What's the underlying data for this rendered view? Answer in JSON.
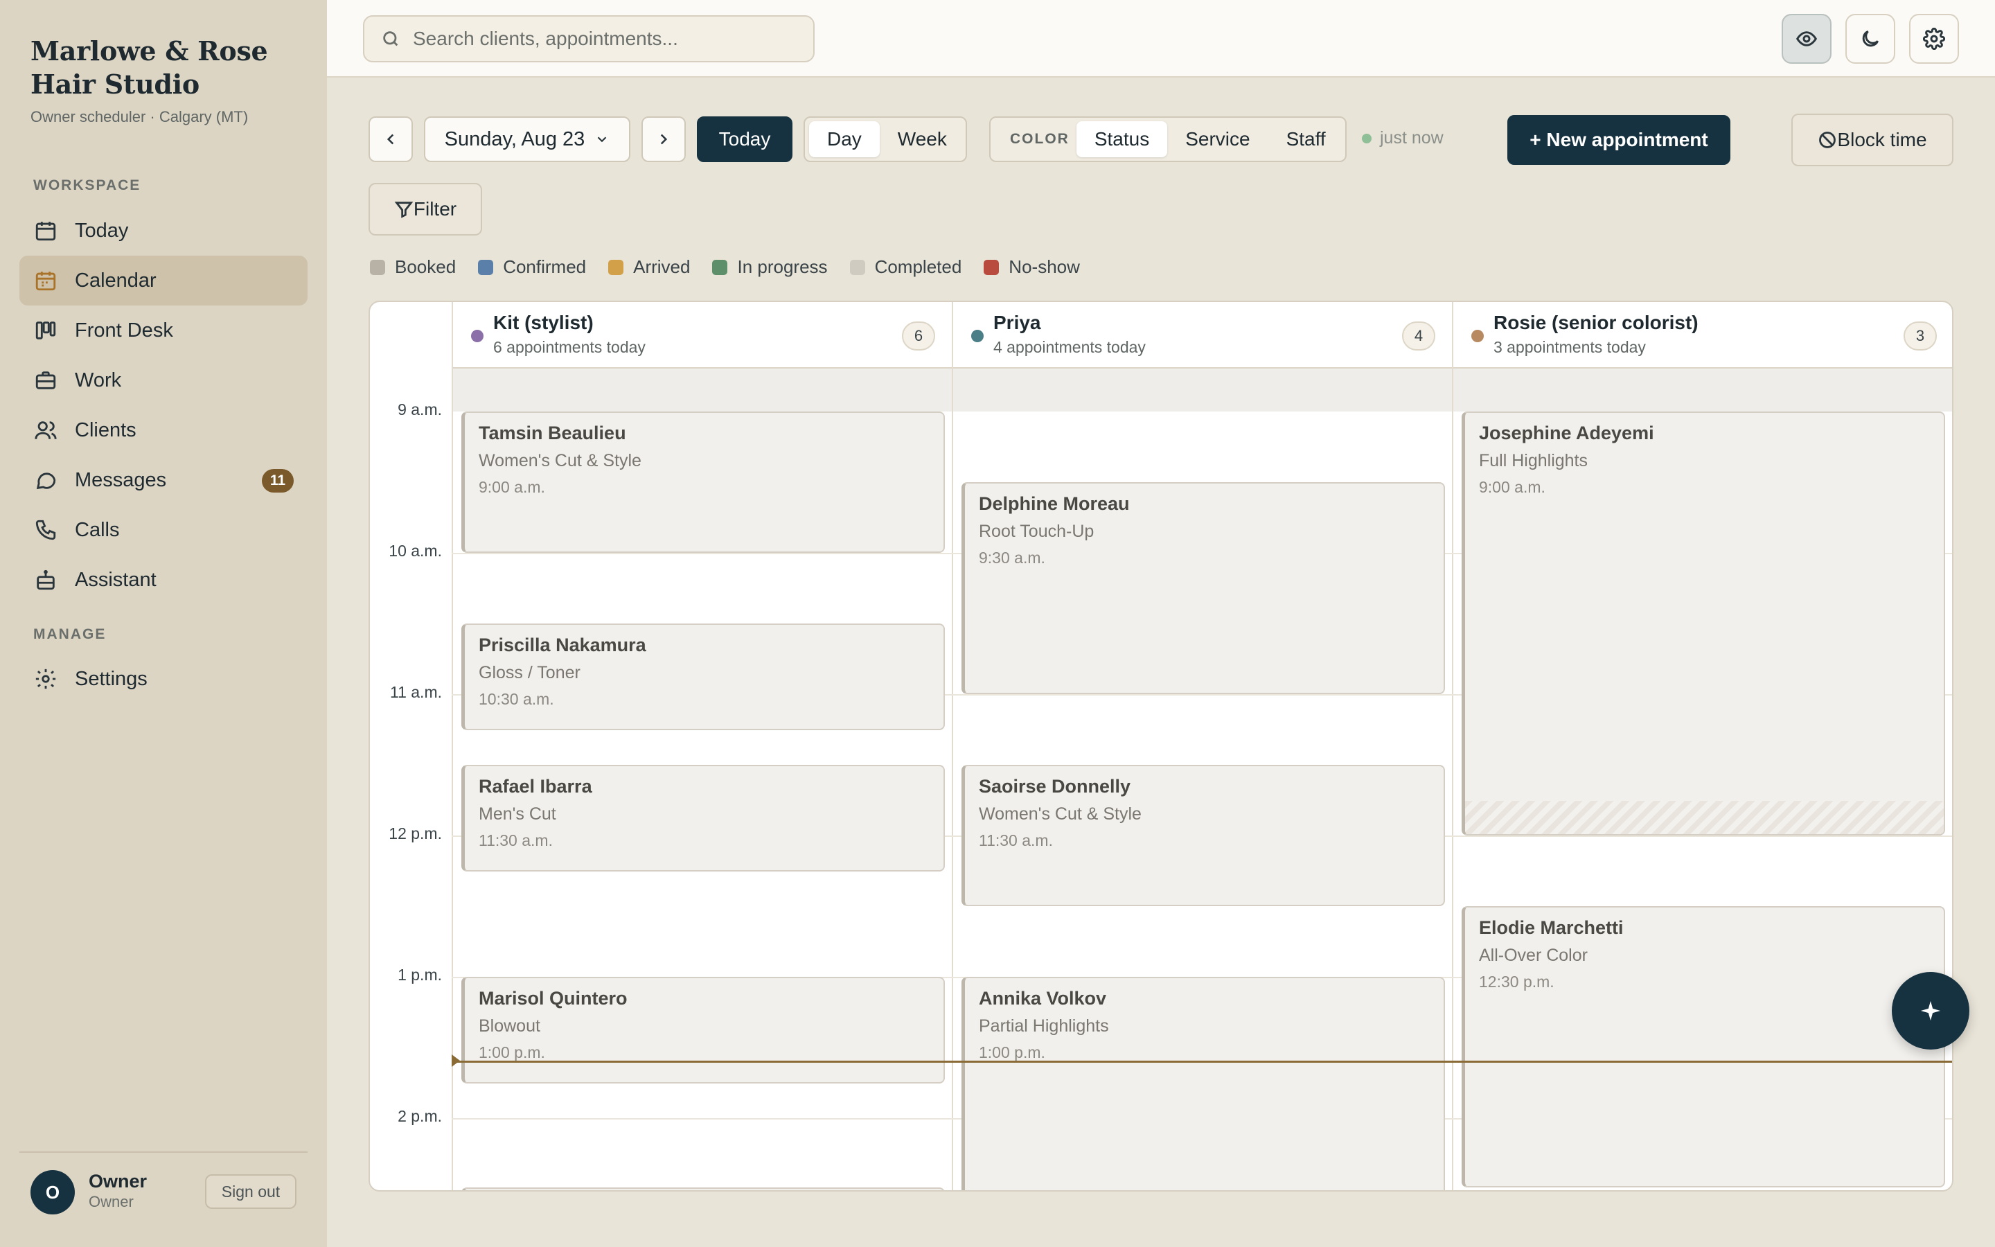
{
  "brand": {
    "name": "Marlowe & Rose Hair Studio",
    "subtitle": "Owner scheduler · Calgary (MT)"
  },
  "sidebar": {
    "workspace_label": "WORKSPACE",
    "manage_label": "MANAGE",
    "items": [
      {
        "label": "Today",
        "icon": "calendar-icon"
      },
      {
        "label": "Calendar",
        "icon": "calendar-grid-icon",
        "active": true
      },
      {
        "label": "Front Desk",
        "icon": "kanban-icon"
      },
      {
        "label": "Work",
        "icon": "briefcase-icon"
      },
      {
        "label": "Clients",
        "icon": "users-icon"
      },
      {
        "label": "Messages",
        "icon": "chat-icon",
        "badge": "11"
      },
      {
        "label": "Calls",
        "icon": "phone-icon"
      },
      {
        "label": "Assistant",
        "icon": "bot-icon"
      }
    ],
    "manage_items": [
      {
        "label": "Settings",
        "icon": "gear-icon"
      }
    ]
  },
  "user": {
    "initial": "O",
    "name": "Owner",
    "role": "Owner",
    "signout_label": "Sign out"
  },
  "search": {
    "placeholder": "Search clients, appointments..."
  },
  "topbar": {
    "icons": [
      "eye-icon",
      "moon-icon",
      "gear-icon"
    ]
  },
  "toolbar": {
    "date_label": "Sunday, Aug 23",
    "today_label": "Today",
    "view_options": [
      "Day",
      "Week"
    ],
    "view_selected": "Day",
    "color_label": "COLOR",
    "color_options": [
      "Status",
      "Service",
      "Staff"
    ],
    "color_selected": "Status",
    "sync_status": "just now",
    "new_appointment_label": "+ New appointment",
    "block_time_label": "Block time",
    "filter_label": "Filter"
  },
  "legend": [
    {
      "label": "Booked",
      "color": "#b7b1a6"
    },
    {
      "label": "Confirmed",
      "color": "#5a7fa8"
    },
    {
      "label": "Arrived",
      "color": "#d2a048"
    },
    {
      "label": "In progress",
      "color": "#5c8f6a"
    },
    {
      "label": "Completed",
      "color": "#d0cbc1"
    },
    {
      "label": "No-show",
      "color": "#b84a3e"
    }
  ],
  "calendar": {
    "hours": [
      "9 a.m.",
      "10 a.m.",
      "11 a.m.",
      "12 p.m.",
      "1 p.m.",
      "2 p.m."
    ],
    "columns": [
      {
        "name": "Kit (stylist)",
        "count_text": "6 appointments today",
        "count": "6",
        "color": "#8a6fa8",
        "appointments": [
          {
            "client": "Tamsin Beaulieu",
            "service": "Women's Cut & Style",
            "time": "9:00 a.m."
          },
          {
            "client": "Priscilla Nakamura",
            "service": "Gloss / Toner",
            "time": "10:30 a.m."
          },
          {
            "client": "Rafael Ibarra",
            "service": "Men's Cut",
            "time": "11:30 a.m."
          },
          {
            "client": "Marisol Quintero",
            "service": "Blowout",
            "time": "1:00 p.m."
          }
        ]
      },
      {
        "name": "Priya",
        "count_text": "4 appointments today",
        "count": "4",
        "color": "#4a7f88",
        "appointments": [
          {
            "client": "Delphine Moreau",
            "service": "Root Touch-Up",
            "time": "9:30 a.m."
          },
          {
            "client": "Saoirse Donnelly",
            "service": "Women's Cut & Style",
            "time": "11:30 a.m."
          },
          {
            "client": "Annika Volkov",
            "service": "Partial Highlights",
            "time": "1:00 p.m."
          }
        ]
      },
      {
        "name": "Rosie (senior colorist)",
        "count_text": "3 appointments today",
        "count": "3",
        "color": "#b88a62",
        "appointments": [
          {
            "client": "Josephine Adeyemi",
            "service": "Full Highlights",
            "time": "9:00 a.m."
          },
          {
            "client": "Elodie Marchetti",
            "service": "All-Over Color",
            "time": "12:30 p.m."
          }
        ]
      }
    ]
  },
  "assistant_fab": {
    "icon": "sparkle-icon"
  }
}
